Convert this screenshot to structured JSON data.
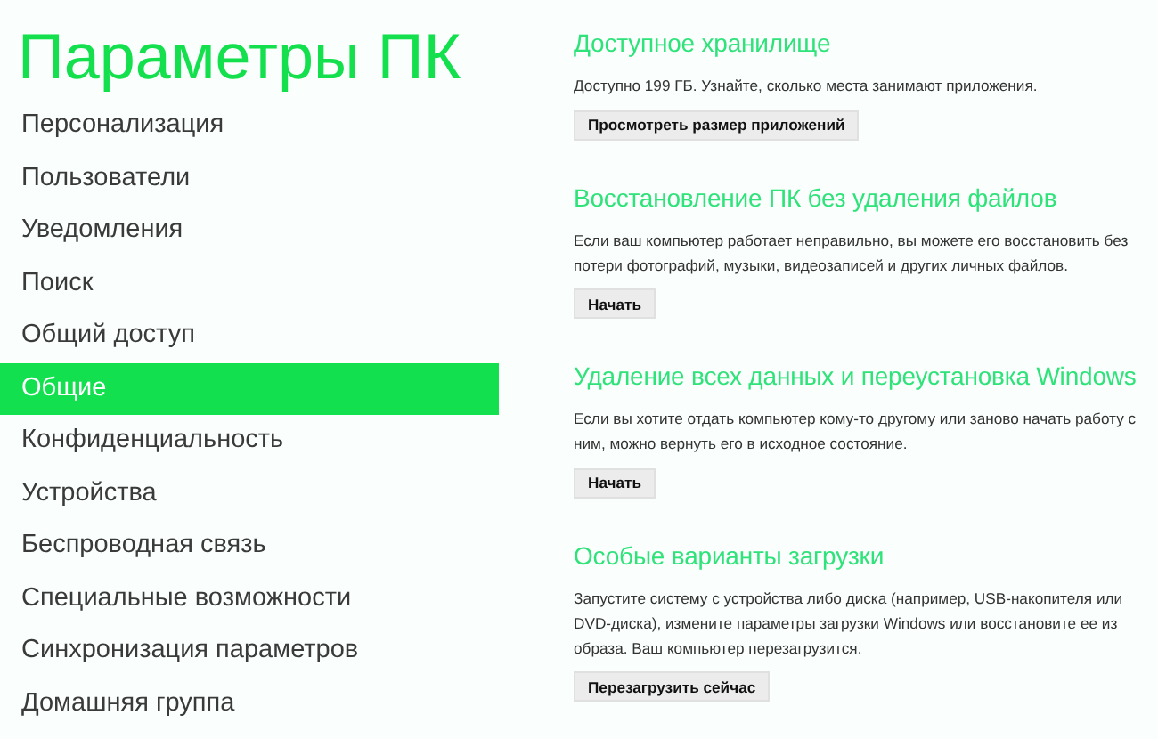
{
  "title": "Параметры ПК",
  "sidebar": {
    "items": [
      {
        "label": "Персонализация",
        "selected": false
      },
      {
        "label": "Пользователи",
        "selected": false
      },
      {
        "label": "Уведомления",
        "selected": false
      },
      {
        "label": "Поиск",
        "selected": false
      },
      {
        "label": "Общий доступ",
        "selected": false
      },
      {
        "label": "Общие",
        "selected": true
      },
      {
        "label": "Конфиденциальность",
        "selected": false
      },
      {
        "label": "Устройства",
        "selected": false
      },
      {
        "label": "Беспроводная связь",
        "selected": false
      },
      {
        "label": "Специальные возможности",
        "selected": false
      },
      {
        "label": "Синхронизация параметров",
        "selected": false
      },
      {
        "label": "Домашняя группа",
        "selected": false
      }
    ]
  },
  "sections": [
    {
      "heading": "Доступное хранилище",
      "text": "Доступно 199 ГБ. Узнайте, сколько места занимают приложения.",
      "button": "Просмотреть размер приложений"
    },
    {
      "heading": "Восстановление ПК без удаления файлов",
      "text": "Если ваш компьютер работает неправильно, вы можете его восстановить без потери фотографий, музыки, видеозаписей и других личных файлов.",
      "button": "Начать"
    },
    {
      "heading": "Удаление всех данных и переустановка Windows",
      "text": "Если вы хотите отдать компьютер кому-то другому или заново начать работу с ним, можно вернуть его в исходное состояние.",
      "button": "Начать"
    },
    {
      "heading": "Особые варианты загрузки",
      "text": "Запустите систему с устройства либо диска (например, USB-накопителя или DVD-диска), измените параметры загрузки Windows или восстановите ее из образа. Ваш компьютер перезагрузится.",
      "button": "Перезагрузить сейчас"
    }
  ]
}
